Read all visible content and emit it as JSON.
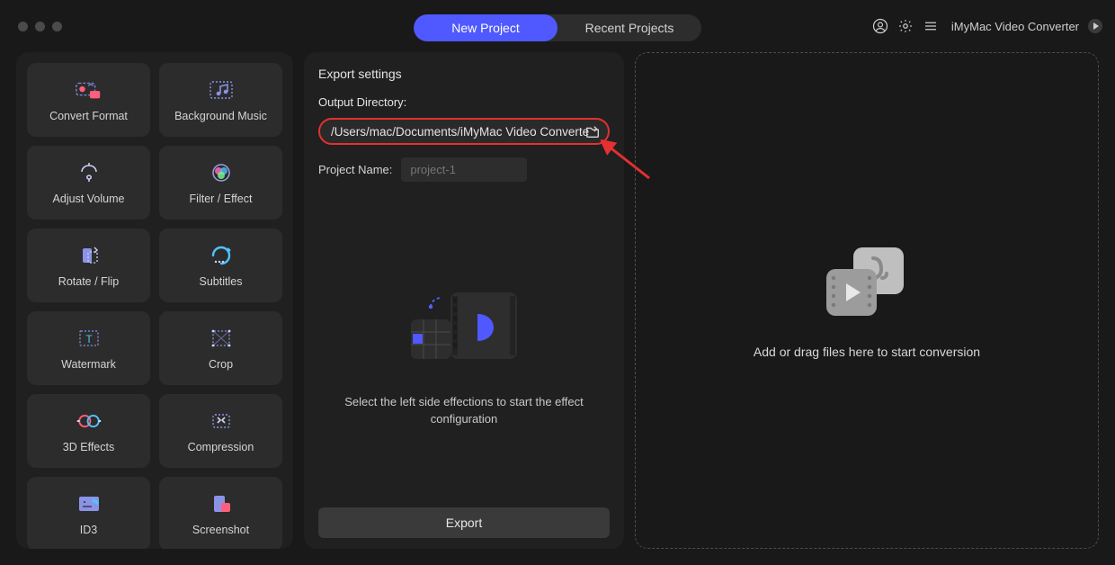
{
  "app": {
    "brand": "iMyMac Video Converter"
  },
  "tabs": {
    "new": "New Project",
    "recent": "Recent Projects"
  },
  "sidebar": {
    "items": [
      {
        "label": "Convert Format"
      },
      {
        "label": "Background Music"
      },
      {
        "label": "Adjust Volume"
      },
      {
        "label": "Filter / Effect"
      },
      {
        "label": "Rotate / Flip"
      },
      {
        "label": "Subtitles"
      },
      {
        "label": "Watermark"
      },
      {
        "label": "Crop"
      },
      {
        "label": "3D Effects"
      },
      {
        "label": "Compression"
      },
      {
        "label": "ID3"
      },
      {
        "label": "Screenshot"
      }
    ]
  },
  "export": {
    "heading": "Export settings",
    "dir_label": "Output Directory:",
    "dir_value": "/Users/mac/Documents/iMyMac Video Converte",
    "name_label": "Project Name:",
    "name_placeholder": "project-1",
    "caption": "Select the left side effections to start the effect configuration",
    "button": "Export"
  },
  "drop": {
    "text": "Add or drag files here to start conversion"
  }
}
